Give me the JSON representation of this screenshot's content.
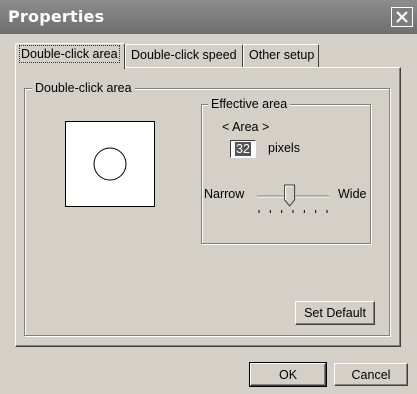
{
  "window": {
    "title": "Properties"
  },
  "tabs": [
    {
      "label": "Double-click area",
      "active": true
    },
    {
      "label": "Double-click speed",
      "active": false
    },
    {
      "label": "Other setup",
      "active": false
    }
  ],
  "area_group": {
    "legend": "Double-click area"
  },
  "effective_group": {
    "legend": "Effective area",
    "area_label": "< Area >",
    "pixels_value": "32",
    "pixels_unit": "pixels",
    "slider_min_label": "Narrow",
    "slider_max_label": "Wide",
    "slider_ticks": 7,
    "slider_position": 0.45,
    "set_default_label": "Set Default"
  },
  "buttons": {
    "ok_label": "OK",
    "cancel_label": "Cancel"
  }
}
